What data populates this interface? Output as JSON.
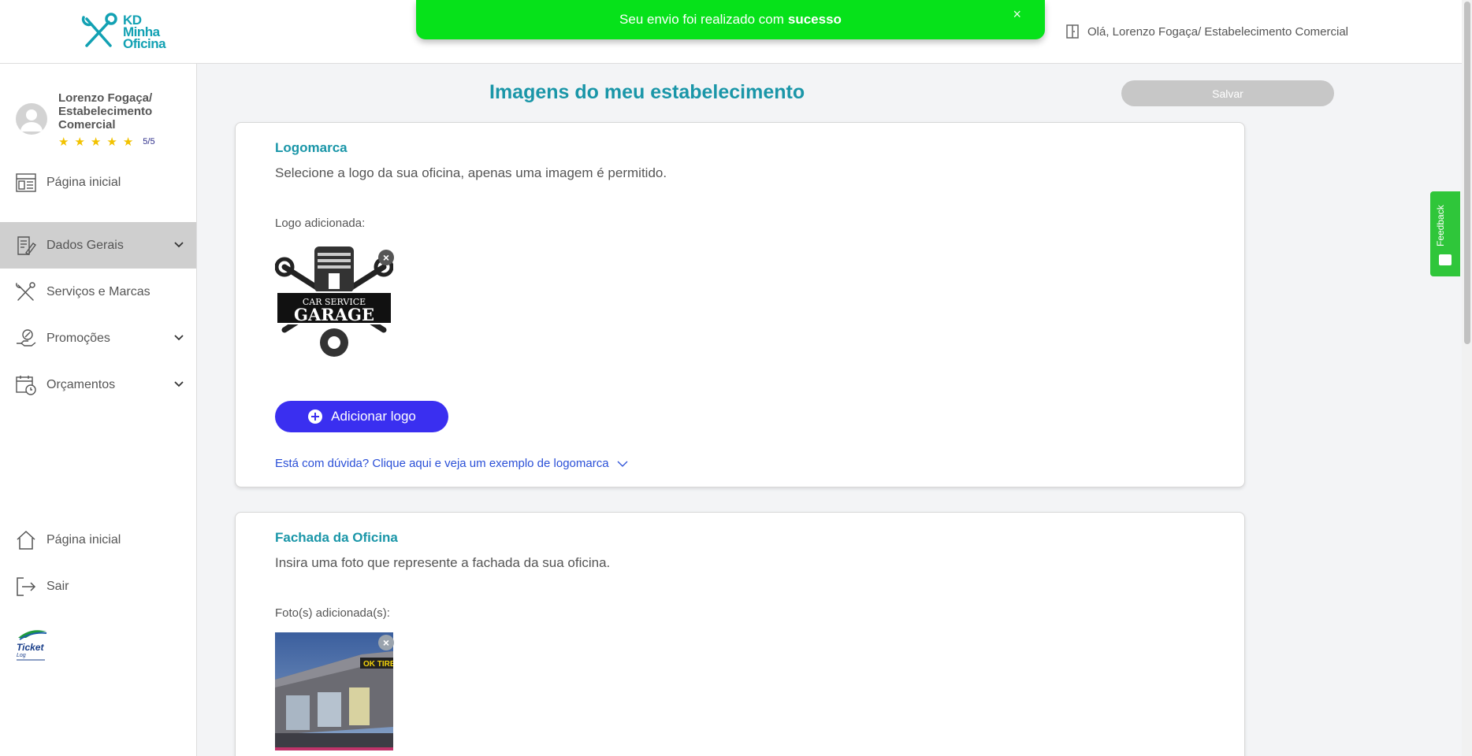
{
  "header": {
    "logo_lines": [
      "KD",
      "Minha",
      "Oficina"
    ],
    "greeting": "Olá, Lorenzo Fogaça/ Estabelecimento Comercial"
  },
  "toast": {
    "message": "Seu envio foi realizado com",
    "emphasis": "sucesso",
    "close": "×"
  },
  "sidebar": {
    "profile": {
      "name": "Lorenzo Fogaça/ Estabelecimento Comercial",
      "stars": 5,
      "rating": "5/5"
    },
    "items": [
      {
        "label": "Página inicial",
        "icon": "dashboard-icon"
      },
      {
        "label": "Dados Gerais",
        "icon": "document-edit-icon",
        "active": true,
        "expandable": true
      },
      {
        "label": "Serviços e Marcas",
        "icon": "tools-icon"
      },
      {
        "label": "Promoções",
        "icon": "promotion-icon",
        "expandable": true
      },
      {
        "label": "Orçamentos",
        "icon": "calendar-icon",
        "expandable": true
      }
    ],
    "bottom_items": [
      {
        "label": "Página inicial",
        "icon": "home-icon"
      },
      {
        "label": "Sair",
        "icon": "logout-icon"
      }
    ],
    "partner_logo": "Ticket Log"
  },
  "main": {
    "title": "Imagens do meu estabelecimento",
    "save_label": "Salvar",
    "logo_section": {
      "title": "Logomarca",
      "description": "Selecione a logo da sua oficina, apenas uma imagem é permitido.",
      "added_label": "Logo adicionada:",
      "logo_text_top": "CAR SERVICE",
      "logo_text_main": "GARAGE",
      "add_button": "Adicionar logo",
      "help_link": "Está com dúvida? Clique aqui e veja um exemplo de logomarca"
    },
    "facade_section": {
      "title": "Fachada da Oficina",
      "description": "Insira uma foto que represente a fachada da sua oficina.",
      "added_label": "Foto(s) adicionada(s):",
      "sign_text": "OK TIRE"
    }
  },
  "feedback_tab": "Feedback",
  "colors": {
    "accent": "#1a96a8",
    "primary_button": "#3a2ff0",
    "toast": "#06e21a",
    "disabled": "#c7c7c7"
  }
}
